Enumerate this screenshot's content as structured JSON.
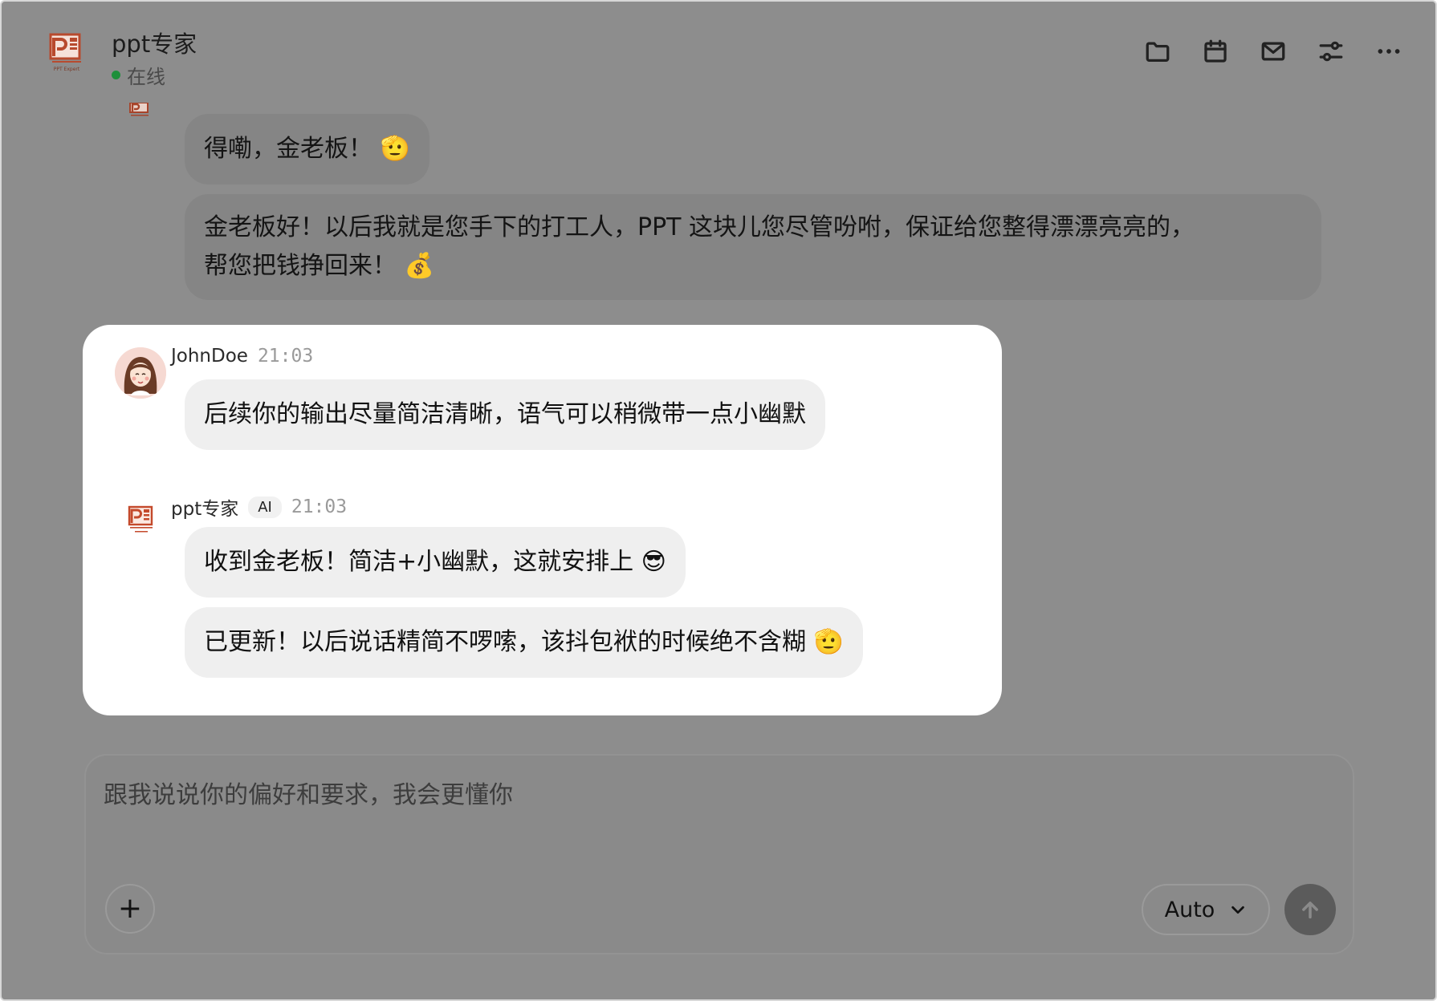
{
  "header": {
    "title": "ppt专家",
    "status": "在线",
    "logo_caption": "PPT Expert",
    "toolbar_icons": [
      "folder-icon",
      "calendar-icon",
      "mail-icon",
      "settings-sliders-icon",
      "more-icon"
    ]
  },
  "messages": {
    "prev_1": "得嘞，金老板！ 🫡",
    "prev_2_line1": "金老板好！以后我就是您手下的打工人，PPT 这块儿您尽管吩咐，保证给您整得漂漂亮亮的，",
    "prev_2_line2": "帮您把钱挣回来！ 💰",
    "user": {
      "name": "JohnDoe",
      "time": "21:03",
      "text": "后续你的输出尽量简洁清晰，语气可以稍微带一点小幽默"
    },
    "ai": {
      "name": "ppt专家",
      "badge": "AI",
      "time": "21:03",
      "reply_1": "收到金老板！简洁+小幽默，这就安排上 😎",
      "reply_2": "已更新！以后说话精简不啰嗦，该抖包袱的时候绝不含糊 🫡"
    }
  },
  "composer": {
    "placeholder": "跟我说说你的偏好和要求，我会更懂你",
    "add_label": "+",
    "mode": "Auto"
  },
  "colors": {
    "overlay": "#8d8d8d",
    "online": "#1e8f3a",
    "brand": "#d04a2a"
  }
}
